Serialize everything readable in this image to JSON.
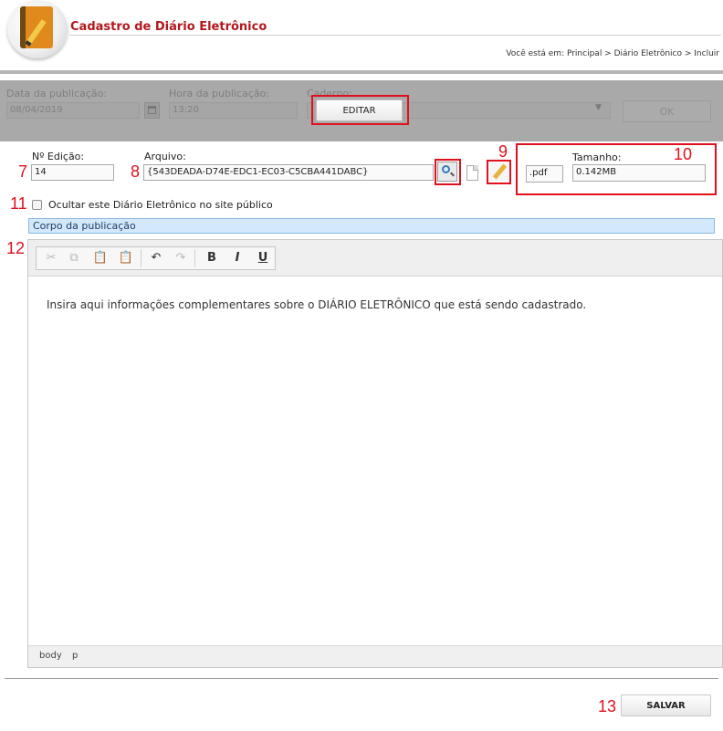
{
  "header": {
    "title": "Cadastro de Diário Eletrônico",
    "breadcrumb": "Você está em: Principal > Diário Eletrônico > Incluir"
  },
  "top_panel": {
    "data_label": "Data da publicação:",
    "data_value": "08/04/2019",
    "hora_label": "Hora da publicação:",
    "hora_value": "13:20",
    "caderno_label": "Caderno:",
    "editar_label": "EDITAR",
    "ok_label": "OK"
  },
  "form": {
    "edicao_label": "Nº Edição:",
    "edicao_value": "14",
    "arquivo_label": "Arquivo:",
    "arquivo_value": "{543DEADA-D74E-EDC1-EC03-C5CBA441DABC}",
    "ext_value": ".pdf",
    "tamanho_label": "Tamanho:",
    "tamanho_value": "0.142MB",
    "ocultar_label": "Ocultar este Diário Eletrônico no site público",
    "corpo_label": "Corpo da publicação"
  },
  "editor": {
    "content": "Insira aqui informações complementares sobre o DIÁRIO ELETRÔNICO que está sendo cadastrado.",
    "path_body": "body",
    "path_p": "p",
    "bold": "B",
    "italic": "I",
    "underline": "U"
  },
  "annotations": {
    "n7": "7",
    "n8": "8",
    "n9": "9",
    "n10": "10",
    "n11": "11",
    "n12": "12",
    "n13": "13"
  },
  "footer": {
    "salvar_label": "SALVAR"
  },
  "colors": {
    "title_red": "#b3181d",
    "annotation_red": "#e0101d",
    "section_blue": "#d4e8fb"
  },
  "icons": [
    "book-pencil-logo-icon",
    "calendar-icon",
    "search-icon",
    "document-icon",
    "edit-pencil-icon",
    "cut-icon",
    "copy-icon",
    "paste-icon",
    "paste-text-icon",
    "undo-icon",
    "redo-icon"
  ]
}
